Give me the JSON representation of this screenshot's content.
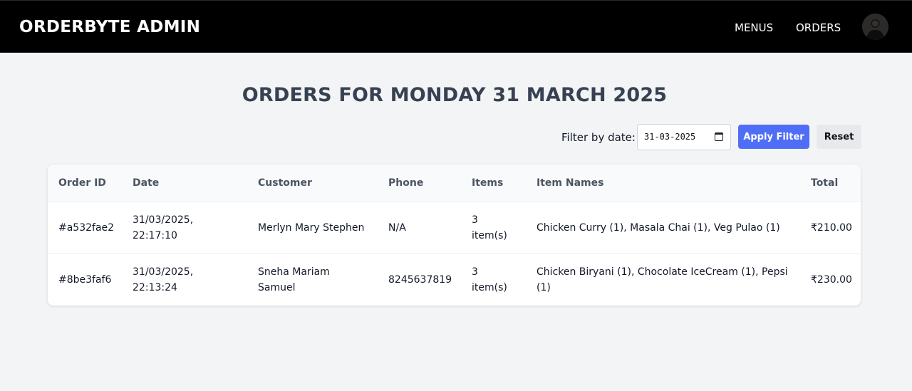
{
  "navbar": {
    "brand": "ORDERBYTE ADMIN",
    "links": [
      {
        "label": "MENUS"
      },
      {
        "label": "ORDERS"
      }
    ]
  },
  "page": {
    "title": "ORDERS FOR MONDAY 31 MARCH 2025"
  },
  "filter": {
    "label": "Filter by date:",
    "date_value": "31-03-2025",
    "apply_label": "Apply Filter",
    "reset_label": "Reset"
  },
  "table": {
    "headers": [
      "Order ID",
      "Date",
      "Customer",
      "Phone",
      "Items",
      "Item Names",
      "Total"
    ],
    "rows": [
      {
        "order_id": "#a532fae2",
        "date_line1": "31/03/2025,",
        "date_line2": "22:17:10",
        "customer": "Merlyn Mary Stephen",
        "phone": "N/A",
        "items_line1": "3",
        "items_line2": "item(s)",
        "item_names": "Chicken Curry (1), Masala Chai (1), Veg Pulao (1)",
        "total": "₹210.00"
      },
      {
        "order_id": "#8be3faf6",
        "date_line1": "31/03/2025,",
        "date_line2": "22:13:24",
        "customer": "Sneha Mariam Samuel",
        "phone": "8245637819",
        "items_line1": "3",
        "items_line2": "item(s)",
        "item_names": "Chicken Biryani (1), Chocolate IceCream (1), Pepsi (1)",
        "total": "₹230.00"
      }
    ]
  },
  "colors": {
    "navbar_bg": "#000000",
    "accent": "#4f6ef7",
    "page_bg": "#f3f4f6"
  }
}
